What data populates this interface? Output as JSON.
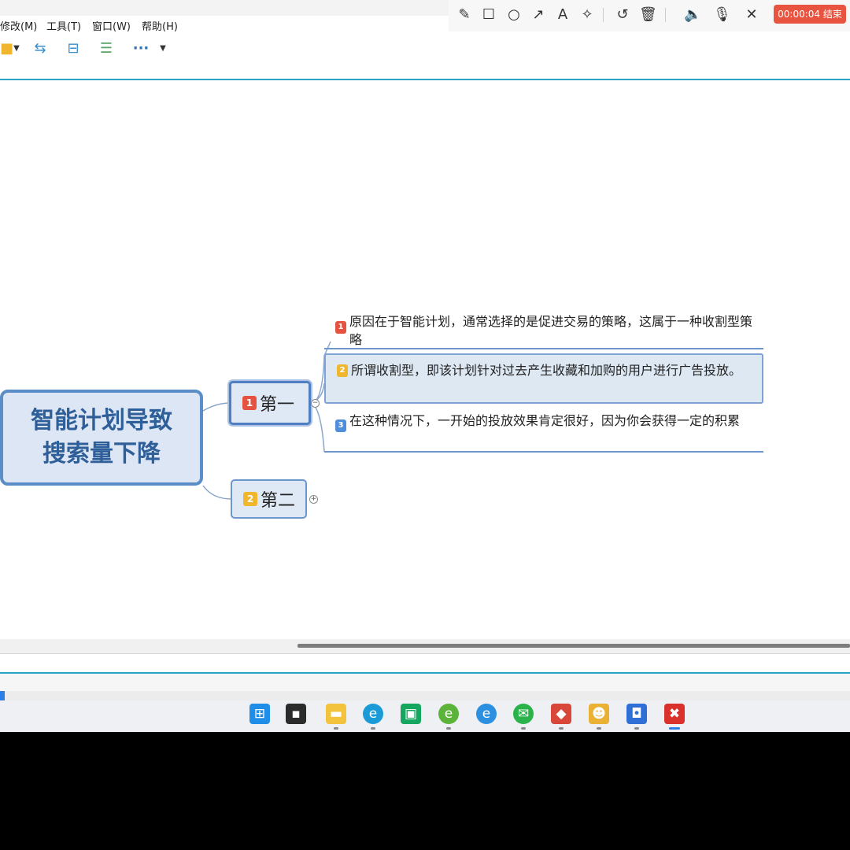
{
  "menu": {
    "items": [
      "修改(M)",
      "工具(T)",
      "窗口(W)",
      "帮助(H)"
    ]
  },
  "recorder": {
    "tools": [
      "pencil-icon",
      "rectangle-icon",
      "circle-icon",
      "arrow-icon",
      "text-icon",
      "magic-wand-icon",
      "undo-icon",
      "trash-icon",
      "speaker-icon",
      "microphone-icon",
      "close-icon"
    ],
    "timer_label": "00:00:04 结束"
  },
  "toolbar": {
    "more_label": "···"
  },
  "mindmap": {
    "root": "智能计划导致搜索量下降",
    "topics": [
      {
        "badge": "1",
        "label": "第一"
      },
      {
        "badge": "2",
        "label": "第二"
      }
    ],
    "subtopics": [
      {
        "badge": "1",
        "text": "原因在于智能计划，通常选择的是促进交易的策略，这属于一种收割型策略"
      },
      {
        "badge": "2",
        "text": "所谓收割型，即该计划针对过去产生收藏和加购的用户进行广告投放。"
      },
      {
        "badge": "3",
        "text": "在这种情况下，一开始的投放效果肯定很好，因为你会获得一定的积累"
      }
    ]
  },
  "colors": {
    "accent": "#2aa3c4",
    "root_border": "#5b8dc9",
    "root_text": "#2f5f99",
    "badge_red": "#e4533f",
    "badge_yellow": "#f0b62e",
    "badge_blue": "#4f8edb",
    "timer_bg": "#e8543f"
  }
}
